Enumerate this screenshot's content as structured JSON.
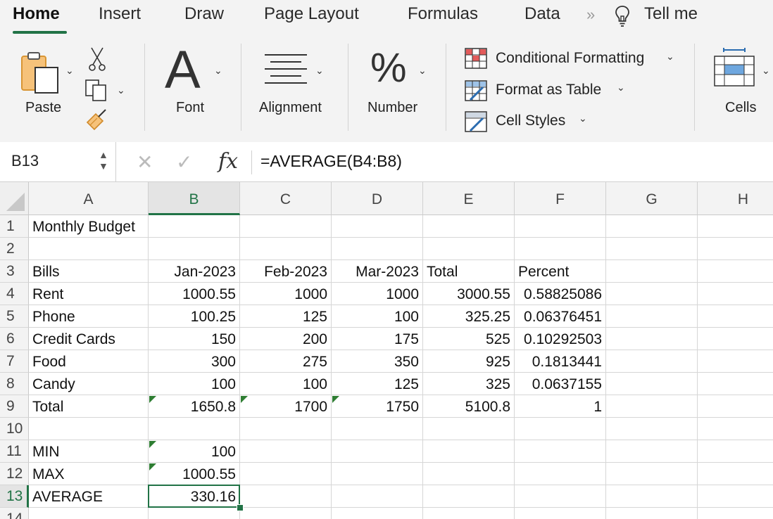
{
  "ribbon_tabs": [
    "Home",
    "Insert",
    "Draw",
    "Page Layout",
    "Formulas",
    "Data"
  ],
  "tell_me": "Tell me",
  "groups": {
    "paste": "Paste",
    "font": "Font",
    "alignment": "Alignment",
    "number": "Number",
    "cells": "Cells"
  },
  "font_glyph": "A",
  "number_glyph": "%",
  "styles": {
    "conditional_formatting": "Conditional Formatting",
    "format_as_table": "Format as Table",
    "cell_styles": "Cell Styles"
  },
  "formula_bar": {
    "name_box": "B13",
    "fx_label": "fx",
    "formula": "=AVERAGE(B4:B8)"
  },
  "columns": [
    "A",
    "B",
    "C",
    "D",
    "E",
    "F",
    "G",
    "H"
  ],
  "rows": [
    {
      "n": "1",
      "cells": [
        "Monthly Budget",
        "",
        "",
        "",
        "",
        "",
        "",
        ""
      ]
    },
    {
      "n": "2",
      "cells": [
        "",
        "",
        "",
        "",
        "",
        "",
        "",
        ""
      ]
    },
    {
      "n": "3",
      "cells": [
        "Bills",
        "Jan-2023",
        "Feb-2023",
        "Mar-2023",
        "Total",
        "Percent",
        "",
        ""
      ]
    },
    {
      "n": "4",
      "cells": [
        "Rent",
        "1000.55",
        "1000",
        "1000",
        "3000.55",
        "0.58825086",
        "",
        ""
      ]
    },
    {
      "n": "5",
      "cells": [
        "Phone",
        "100.25",
        "125",
        "100",
        "325.25",
        "0.06376451",
        "",
        ""
      ]
    },
    {
      "n": "6",
      "cells": [
        "Credit Cards",
        "150",
        "200",
        "175",
        "525",
        "0.10292503",
        "",
        ""
      ]
    },
    {
      "n": "7",
      "cells": [
        "Food",
        "300",
        "275",
        "350",
        "925",
        "0.1813441",
        "",
        ""
      ]
    },
    {
      "n": "8",
      "cells": [
        "Candy",
        "100",
        "100",
        "125",
        "325",
        "0.0637155",
        "",
        ""
      ]
    },
    {
      "n": "9",
      "cells": [
        "Total",
        "1650.8",
        "1700",
        "1750",
        "5100.8",
        "1",
        "",
        ""
      ]
    },
    {
      "n": "10",
      "cells": [
        "",
        "",
        "",
        "",
        "",
        "",
        "",
        ""
      ]
    },
    {
      "n": "11",
      "cells": [
        "MIN",
        "100",
        "",
        "",
        "",
        "",
        "",
        ""
      ]
    },
    {
      "n": "12",
      "cells": [
        "MAX",
        "1000.55",
        "",
        "",
        "",
        "",
        "",
        ""
      ]
    },
    {
      "n": "13",
      "cells": [
        "AVERAGE",
        "330.16",
        "",
        "",
        "",
        "",
        "",
        ""
      ]
    },
    {
      "n": "14",
      "cells": [
        "",
        "",
        "",
        "",
        "",
        "",
        "",
        ""
      ]
    }
  ],
  "alignment": {
    "3": [
      "l",
      "r",
      "r",
      "r",
      "l",
      "l",
      "l",
      "l"
    ]
  },
  "error_indicators": [
    "B9",
    "C9",
    "D9",
    "B11",
    "B12"
  ],
  "selected_cell": "B13",
  "colors": {
    "accent": "#217346",
    "error_triangle": "#2e7d32",
    "ribbon_bg": "#f3f3f3"
  }
}
